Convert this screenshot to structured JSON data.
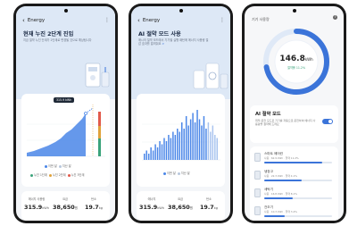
{
  "phone1": {
    "header_title": "Energy",
    "headline": "현재 누진 2단계 진입",
    "description": "지금 절약 누진 단계가 2단계로 변경될 것으로 예상됩니다",
    "tooltip": "315.9 kWh",
    "legend_row1": [
      "이번 달",
      "지난 달"
    ],
    "legend_row2": [
      "누진 1단계",
      "누진 2단계",
      "누진 3단계"
    ],
    "stats": [
      {
        "label": "에너지 사용량",
        "value": "315.9",
        "unit": "kWh"
      },
      {
        "label": "요금",
        "value": "38,650",
        "unit": "원"
      },
      {
        "label": "탄소",
        "value": "19.7",
        "unit": "kg"
      }
    ],
    "colors": {
      "accent": "#3b74d9",
      "area": "#4a86e8",
      "level2": "#e0a23a",
      "level3": "#e25a4a"
    }
  },
  "phone2": {
    "header_title": "Energy",
    "headline": "AI 절약 모드 사용",
    "description": "매시의 절약 모드에서 기기별 실행 패턴에 에너지 사용량 절감 효과를 알려줘요",
    "more_link": ">",
    "legend": [
      "이번 달",
      "지난 달"
    ],
    "bar_values": [
      2,
      3,
      2,
      4,
      3,
      5,
      4,
      6,
      5,
      7,
      6,
      8,
      7,
      9,
      8,
      10,
      9,
      12,
      10,
      14,
      11,
      13,
      15,
      12,
      16,
      13,
      11,
      14,
      10,
      12,
      9,
      11,
      8,
      7
    ],
    "stats": [
      {
        "label": "에너지",
        "value": "315.9",
        "unit": "kWh"
      },
      {
        "label": "요금",
        "value": "38,650",
        "unit": "원"
      },
      {
        "label": "탄소",
        "value": "19.7",
        "unit": "kg"
      }
    ]
  },
  "phone3": {
    "header_title": "기기 사용량",
    "ring_value": "146.8",
    "ring_unit": "kWh",
    "ring_progress": 0.72,
    "ring_sub": "절약률 11.2%",
    "ai_title": "AI 절약 모드",
    "ai_desc": "최적 운전 모드로 기기를 자동으로 운전하여 에너지 사용량을 절약해 드려요",
    "devices": [
      {
        "name": "스마트 에어컨",
        "info": "사용 · 62.9 kWh · 절약 11.2%",
        "level": 0.85
      },
      {
        "name": "냉장고",
        "info": "사용 · 22.3 kWh · 절약 4.1%",
        "level": 0.55
      },
      {
        "name": "세탁기",
        "info": "사용 · 16.8 kWh · 절약 8.1%",
        "level": 0.42
      },
      {
        "name": "건조기",
        "info": "사용 · 10.3 kWh · 절약 3.4%",
        "level": 0.3
      }
    ]
  }
}
